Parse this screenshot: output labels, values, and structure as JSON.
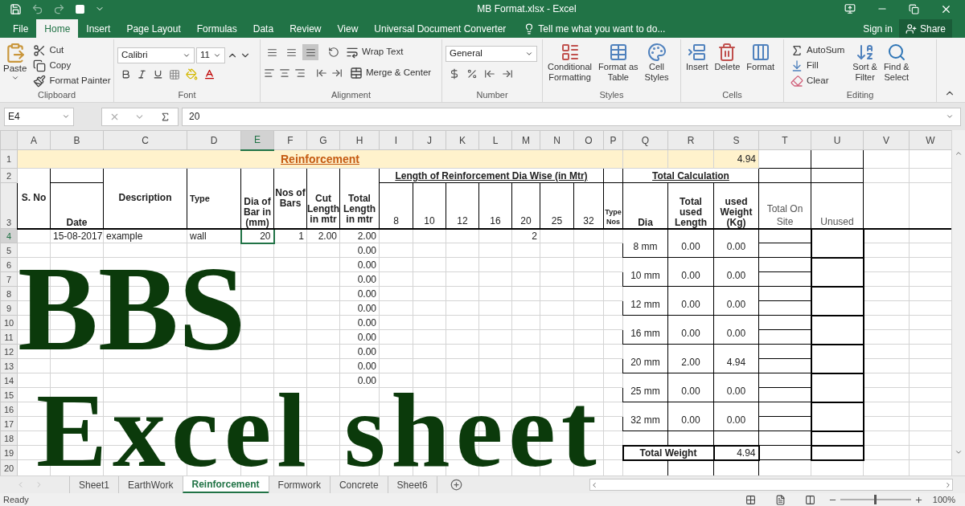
{
  "window": {
    "title": "MB Format.xlsx - Excel"
  },
  "ribbon_tabs": [
    {
      "label": "File",
      "selected": false
    },
    {
      "label": "Home",
      "selected": true
    },
    {
      "label": "Insert",
      "selected": false
    },
    {
      "label": "Page Layout",
      "selected": false
    },
    {
      "label": "Formulas",
      "selected": false
    },
    {
      "label": "Data",
      "selected": false
    },
    {
      "label": "Review",
      "selected": false
    },
    {
      "label": "View",
      "selected": false
    },
    {
      "label": "Universal Document Converter",
      "selected": false
    }
  ],
  "tell_me": {
    "placeholder": "Tell me what you want to do..."
  },
  "account": {
    "sign_in": "Sign in",
    "share": "Share"
  },
  "ribbon": {
    "clipboard": {
      "label": "Clipboard",
      "paste": "Paste",
      "cut": "Cut",
      "copy": "Copy",
      "format_painter": "Format Painter"
    },
    "font": {
      "label": "Font",
      "font_name": "Calibri",
      "font_size": "11"
    },
    "alignment": {
      "label": "Alignment",
      "wrap_text": "Wrap Text",
      "merge_center": "Merge & Center",
      "vertical_align": [
        {
          "selected": false
        },
        {
          "selected": false
        },
        {
          "selected": true
        }
      ]
    },
    "number": {
      "label": "Number",
      "format": "General"
    },
    "styles": {
      "label": "Styles",
      "buttons": [
        [
          "Conditional",
          "Formatting"
        ],
        [
          "Format as",
          "Table"
        ],
        [
          "Cell",
          "Styles"
        ]
      ]
    },
    "cells": {
      "label": "Cells",
      "buttons": [
        "Insert",
        "Delete",
        "Format"
      ]
    },
    "editing": {
      "label": "Editing",
      "autosum": "AutoSum",
      "fill": "Fill",
      "clear": "Clear",
      "sort_filter": [
        "Sort &",
        "Filter"
      ],
      "find_select": [
        "Find &",
        "Select"
      ]
    }
  },
  "formula_bar": {
    "name_box": "E4",
    "value": "20"
  },
  "columns": [
    {
      "label": "A",
      "selected": false
    },
    {
      "label": "B",
      "selected": false
    },
    {
      "label": "C",
      "selected": false
    },
    {
      "label": "D",
      "selected": false
    },
    {
      "label": "E",
      "selected": true
    },
    {
      "label": "F",
      "selected": false
    },
    {
      "label": "G",
      "selected": false
    },
    {
      "label": "H",
      "selected": false
    },
    {
      "label": "I",
      "selected": false
    },
    {
      "label": "J",
      "selected": false
    },
    {
      "label": "K",
      "selected": false
    },
    {
      "label": "L",
      "selected": false
    },
    {
      "label": "M",
      "selected": false
    },
    {
      "label": "N",
      "selected": false
    },
    {
      "label": "O",
      "selected": false
    },
    {
      "label": "P",
      "selected": false
    },
    {
      "label": "Q",
      "selected": false
    },
    {
      "label": "R",
      "selected": false
    },
    {
      "label": "S",
      "selected": false
    },
    {
      "label": "T",
      "selected": false
    },
    {
      "label": "U",
      "selected": false
    },
    {
      "label": "V",
      "selected": false
    },
    {
      "label": "W",
      "selected": false
    }
  ],
  "rows": [
    {
      "label": "1",
      "selected": false
    },
    {
      "label": "2",
      "selected": false
    },
    {
      "label": "3",
      "selected": false
    },
    {
      "label": "4",
      "selected": true
    },
    {
      "label": "5",
      "selected": false
    },
    {
      "label": "6",
      "selected": false
    },
    {
      "label": "7",
      "selected": false
    },
    {
      "label": "8",
      "selected": false
    },
    {
      "label": "9",
      "selected": false
    },
    {
      "label": "10",
      "selected": false
    },
    {
      "label": "11",
      "selected": false
    },
    {
      "label": "12",
      "selected": false
    },
    {
      "label": "13",
      "selected": false
    },
    {
      "label": "14",
      "selected": false
    },
    {
      "label": "15",
      "selected": false
    },
    {
      "label": "16",
      "selected": false
    },
    {
      "label": "17",
      "selected": false
    },
    {
      "label": "18",
      "selected": false
    },
    {
      "label": "19",
      "selected": false
    },
    {
      "label": "20",
      "selected": false
    }
  ],
  "sheet": {
    "title": "Reinforcement",
    "title_total": "4.94",
    "headers": {
      "s_no": "S. No",
      "date": "Date",
      "description": "Description",
      "type": "Type",
      "dia_of_bar": "Dia of Bar in (mm)",
      "nos_of_bars": "Nos of Bars",
      "cut_length": "Cut Length in mtr",
      "total_length": "Total Length in mtr",
      "length_group": "Length of Reinforcement Dia Wise (in Mtr)",
      "dias": [
        "8",
        "10",
        "12",
        "16",
        "20",
        "25",
        "32"
      ],
      "type_nos": "Type Nos",
      "total_calculation": "Total Calculation",
      "dia": "Dia",
      "total_used_length": "Total used Length",
      "used_weight": "used Weight (Kg)",
      "total_on_site": "Total On Site",
      "unused": "Unused"
    },
    "entries": [
      {
        "date": "15-08-2017",
        "description": "example",
        "type": "wall",
        "dia": "20",
        "nos": "1",
        "cut_length": "2.00",
        "total_length": "2.00",
        "lengths": {
          "d20": "2"
        }
      },
      {
        "total_length": "0.00"
      },
      {
        "total_length": "0.00"
      },
      {
        "total_length": "0.00"
      },
      {
        "total_length": "0.00"
      },
      {
        "total_length": "0.00"
      },
      {
        "total_length": "0.00"
      },
      {
        "total_length": "0.00"
      },
      {
        "total_length": "0.00"
      },
      {
        "total_length": "0.00"
      },
      {
        "total_length": "0.00"
      }
    ],
    "summary": [
      {
        "dia": "8 mm",
        "length": "0.00",
        "weight": "0.00"
      },
      {
        "dia": "10 mm",
        "length": "0.00",
        "weight": "0.00"
      },
      {
        "dia": "12 mm",
        "length": "0.00",
        "weight": "0.00"
      },
      {
        "dia": "16 mm",
        "length": "0.00",
        "weight": "0.00"
      },
      {
        "dia": "20 mm",
        "length": "2.00",
        "weight": "4.94"
      },
      {
        "dia": "25 mm",
        "length": "0.00",
        "weight": "0.00"
      },
      {
        "dia": "32 mm",
        "length": "0.00",
        "weight": "0.00"
      }
    ],
    "total_weight": {
      "label": "Total Weight",
      "value": "4.94"
    }
  },
  "overlay": {
    "lines": [
      "BBS",
      "Excel sheet"
    ]
  },
  "sheet_tabs": [
    {
      "label": "Sheet1",
      "selected": false
    },
    {
      "label": "EarthWork",
      "selected": false
    },
    {
      "label": "Reinforcement",
      "selected": true
    },
    {
      "label": "Formwork",
      "selected": false
    },
    {
      "label": "Concrete",
      "selected": false
    },
    {
      "label": "Sheet6",
      "selected": false
    }
  ],
  "status_bar": {
    "status": "Ready",
    "zoom": {
      "reading": "100%",
      "level": 0.5
    }
  }
}
